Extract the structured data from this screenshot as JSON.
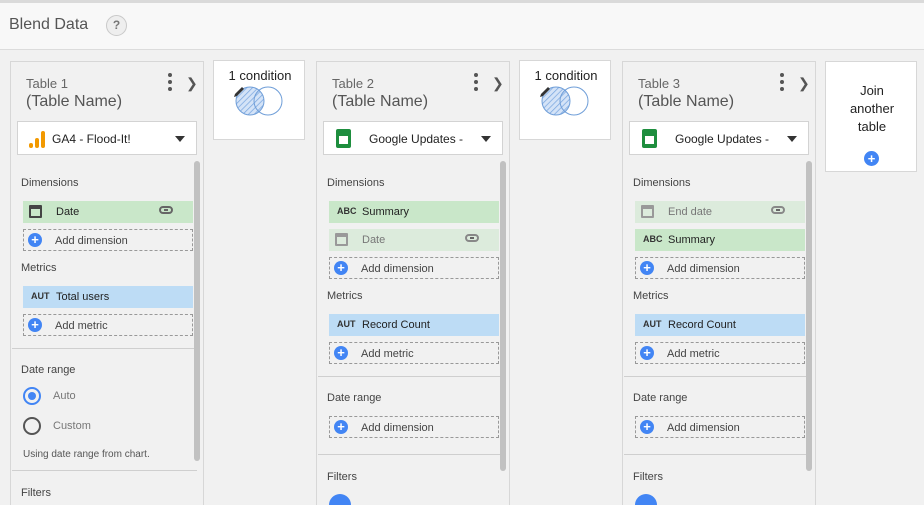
{
  "app": {
    "title": "Blend Data",
    "help": "?"
  },
  "tables": [
    {
      "label": "Table 1",
      "name": "(Table Name)",
      "source": "GA4 - Flood-It!",
      "sections": {
        "dimensions": "Dimensions",
        "metrics": "Metrics",
        "date_range": "Date range",
        "filters": "Filters"
      },
      "dimensions": [
        {
          "label": "Date",
          "type": "date",
          "linked": true
        }
      ],
      "add_dimension": "Add dimension",
      "metrics": [
        {
          "label": "Total users",
          "type": "AUT"
        }
      ],
      "add_metric": "Add metric",
      "date_range": {
        "options": [
          "Auto",
          "Custom"
        ],
        "selected": "Auto",
        "hint": "Using date range from chart."
      }
    },
    {
      "label": "Table 2",
      "name": "(Table Name)",
      "source": "Google Updates -",
      "sections": {
        "dimensions": "Dimensions",
        "metrics": "Metrics",
        "date_range": "Date range",
        "filters": "Filters"
      },
      "dimensions": [
        {
          "label": "Summary",
          "type": "ABC"
        },
        {
          "label": "Date",
          "type": "date",
          "linked": true,
          "faded": true
        }
      ],
      "add_dimension": "Add dimension",
      "metrics": [
        {
          "label": "Record Count",
          "type": "AUT"
        }
      ],
      "add_metric": "Add metric",
      "date_range_add": "Add dimension"
    },
    {
      "label": "Table 3",
      "name": "(Table Name)",
      "source": "Google Updates -",
      "sections": {
        "dimensions": "Dimensions",
        "metrics": "Metrics",
        "date_range": "Date range",
        "filters": "Filters"
      },
      "dimensions": [
        {
          "label": "End date",
          "type": "date",
          "linked": true,
          "faded": true
        },
        {
          "label": "Summary",
          "type": "ABC"
        }
      ],
      "add_dimension": "Add dimension",
      "metrics": [
        {
          "label": "Record Count",
          "type": "AUT"
        }
      ],
      "add_metric": "Add metric",
      "date_range_add": "Add dimension"
    }
  ],
  "conditions": [
    {
      "label": "1 condition"
    },
    {
      "label": "1 condition"
    }
  ],
  "join": {
    "line1": "Join",
    "line2": "another",
    "line3": "table"
  },
  "colors": {
    "dimension": "#c9e7c9",
    "metric": "#bddcf5",
    "accent": "#4285f4",
    "ga_orange": "#f29900",
    "sheets_green": "#1e8e3e"
  }
}
